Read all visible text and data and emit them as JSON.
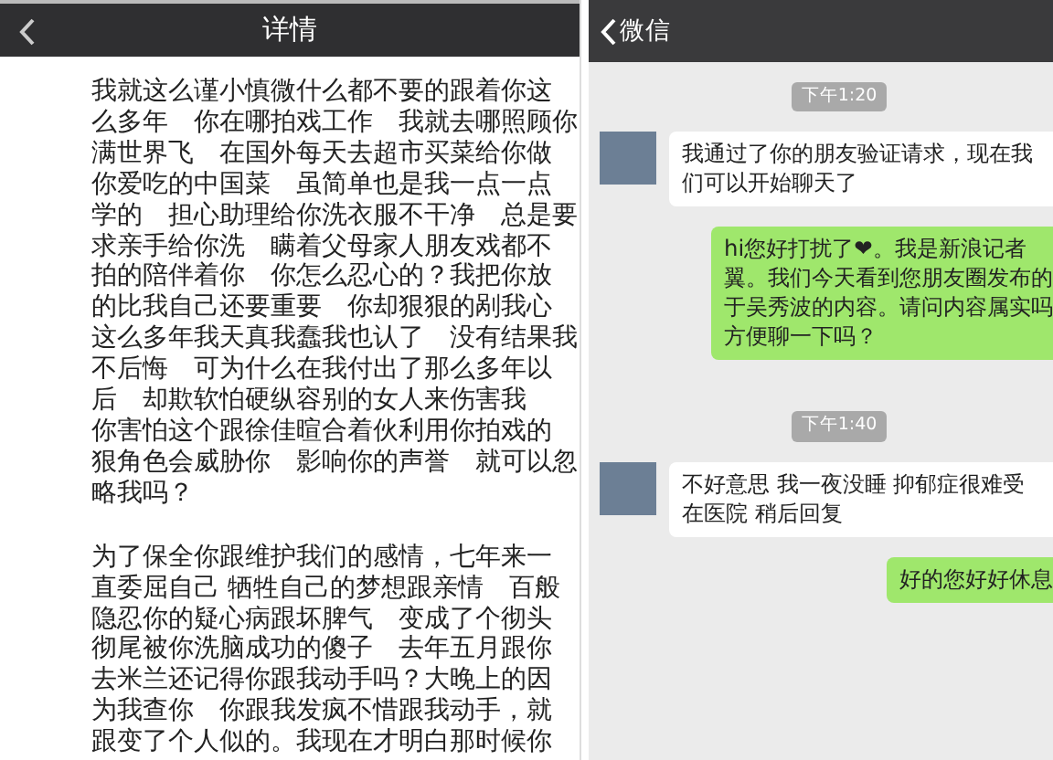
{
  "left_panel": {
    "header": {
      "title": "详情"
    },
    "paragraphs": [
      {
        "lines": [
          "我就这么谨小慎微什么都不要的跟着你这",
          "么多年　你在哪拍戏工作　我就去哪照顾你",
          "满世界飞　在国外每天去超市买菜给你做",
          "你爱吃的中国菜　虽简单也是我一点一点",
          "学的　担心助理给你洗衣服不干净　总是要",
          "求亲手给你洗　瞒着父母家人朋友戏都不",
          "拍的陪伴着你　你怎么忍心的？我把你放",
          "的比我自己还要重要　你却狠狠的剐我心",
          "这么多年我天真我蠢我也认了　没有结果我",
          "不后悔　可为什么在我付出了那么多年以",
          "后　却欺软怕硬纵容别的女人来伤害我",
          "你害怕这个跟徐佳暄合着伙利用你拍戏的",
          "狠角色会威胁你　影响你的声誉　就可以忽",
          "略我吗？"
        ]
      },
      {
        "lines": [
          "为了保全你跟维护我们的感情，七年来一",
          "直委屈自己 牺牲自己的梦想跟亲情　百般",
          "隐忍你的疑心病跟坏脾气　变成了个彻头",
          "彻尾被你洗脑成功的傻子　去年五月跟你",
          "去米兰还记得你跟我动手吗？大晚上的因",
          "为我查你　你跟我发疯不惜跟我动手，就",
          "跟变了个人似的。我现在才明白那时候你"
        ]
      }
    ]
  },
  "right_panel": {
    "header": {
      "back_label": "微信"
    },
    "messages": [
      {
        "kind": "time",
        "text": "下午1:20"
      },
      {
        "kind": "received",
        "lines": [
          "我通过了你的朋友验证请求，现在我",
          "们可以开始聊天了"
        ]
      },
      {
        "kind": "sent",
        "lines": [
          "hi您好打扰了❤。我是新浪记者",
          "翼。我们今天看到您朋友圈发布的",
          "于吴秀波的内容。请问内容属实吗",
          "方便聊一下吗？"
        ]
      },
      {
        "kind": "time",
        "text": "下午1:40"
      },
      {
        "kind": "received",
        "lines": [
          "不好意思 我一夜没睡  抑郁症很难受",
          "在医院 稍后回复"
        ]
      },
      {
        "kind": "sent",
        "lines": [
          "好的您好好休息"
        ]
      }
    ]
  }
}
